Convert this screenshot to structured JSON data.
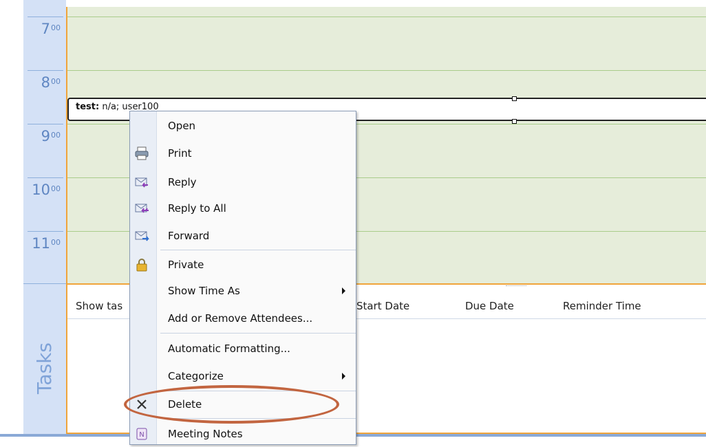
{
  "time_ruler": {
    "hours": [
      {
        "hour": "7",
        "minutes": "00"
      },
      {
        "hour": "8",
        "minutes": "00"
      },
      {
        "hour": "9",
        "minutes": "00"
      },
      {
        "hour": "10",
        "minutes": "00"
      },
      {
        "hour": "11",
        "minutes": "00"
      }
    ]
  },
  "appointment": {
    "subject": "test:",
    "details": "n/a; user100"
  },
  "tasks": {
    "pane_label": "Tasks",
    "columns": {
      "show_tasks": "Show tas",
      "start_date": "Start Date",
      "due_date": "Due Date",
      "reminder_time": "Reminder Time"
    }
  },
  "context_menu": {
    "items": [
      {
        "label": "Open",
        "icon": "",
        "submenu": false
      },
      {
        "label": "Print",
        "icon": "printer-icon",
        "submenu": false
      },
      {
        "label": "Reply",
        "icon": "reply-icon",
        "submenu": false
      },
      {
        "label": "Reply to All",
        "icon": "reply-all-icon",
        "submenu": false
      },
      {
        "label": "Forward",
        "icon": "forward-icon",
        "submenu": false
      },
      {
        "label": "Private",
        "icon": "lock-icon",
        "submenu": false
      },
      {
        "label": "Show Time As",
        "icon": "",
        "submenu": true
      },
      {
        "label": "Add or Remove Attendees...",
        "icon": "",
        "submenu": false
      },
      {
        "label": "Automatic Formatting...",
        "icon": "",
        "submenu": false
      },
      {
        "label": "Categorize",
        "icon": "",
        "submenu": true
      },
      {
        "label": "Delete",
        "icon": "delete-x-icon",
        "submenu": false
      },
      {
        "label": "Meeting Notes",
        "icon": "onenote-icon",
        "submenu": false
      }
    ]
  },
  "colors": {
    "ruler_bg": "#d4e1f6",
    "grid_bg": "#e6edda",
    "accent_orange": "#f0a43a",
    "highlight_oval": "#c26540"
  }
}
